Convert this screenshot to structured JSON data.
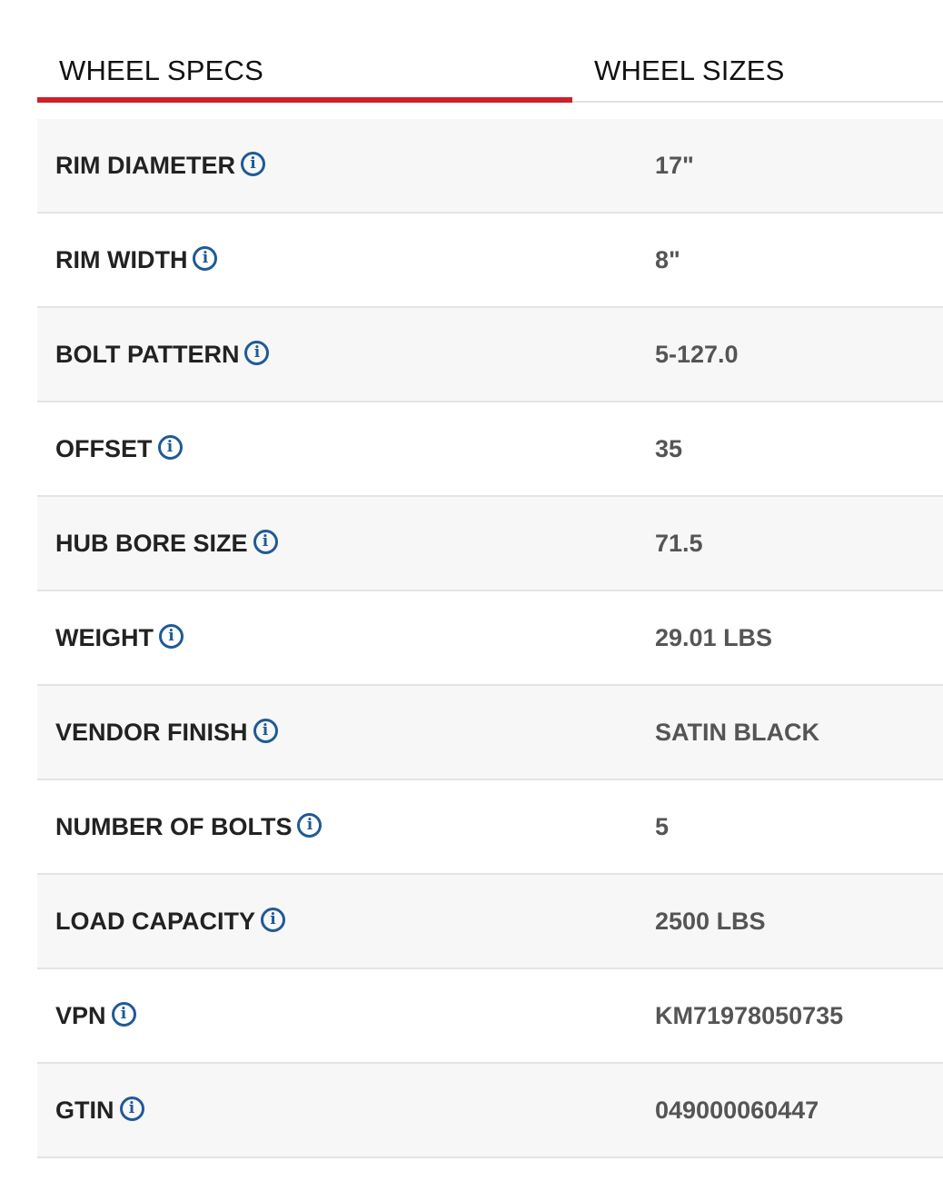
{
  "tabs": {
    "specs_label": "WHEEL SPECS",
    "sizes_label": "WHEEL SIZES",
    "active": "WHEEL SPECS",
    "accent_color": "#cc2229"
  },
  "icons": {
    "info": "info-icon",
    "info_glyph": "i",
    "info_color": "#1f5a96"
  },
  "specs": [
    {
      "label": "RIM DIAMETER",
      "value": "17\""
    },
    {
      "label": "RIM WIDTH",
      "value": "8\""
    },
    {
      "label": "BOLT PATTERN",
      "value": "5-127.0"
    },
    {
      "label": "OFFSET",
      "value": "35"
    },
    {
      "label": "HUB BORE SIZE",
      "value": "71.5"
    },
    {
      "label": "WEIGHT",
      "value": "29.01 LBS"
    },
    {
      "label": "VENDOR FINISH",
      "value": "SATIN BLACK"
    },
    {
      "label": "NUMBER OF BOLTS",
      "value": "5"
    },
    {
      "label": "LOAD CAPACITY",
      "value": "2500 LBS"
    },
    {
      "label": "VPN",
      "value": "KM71978050735"
    },
    {
      "label": "GTIN",
      "value": "049000060447"
    }
  ]
}
